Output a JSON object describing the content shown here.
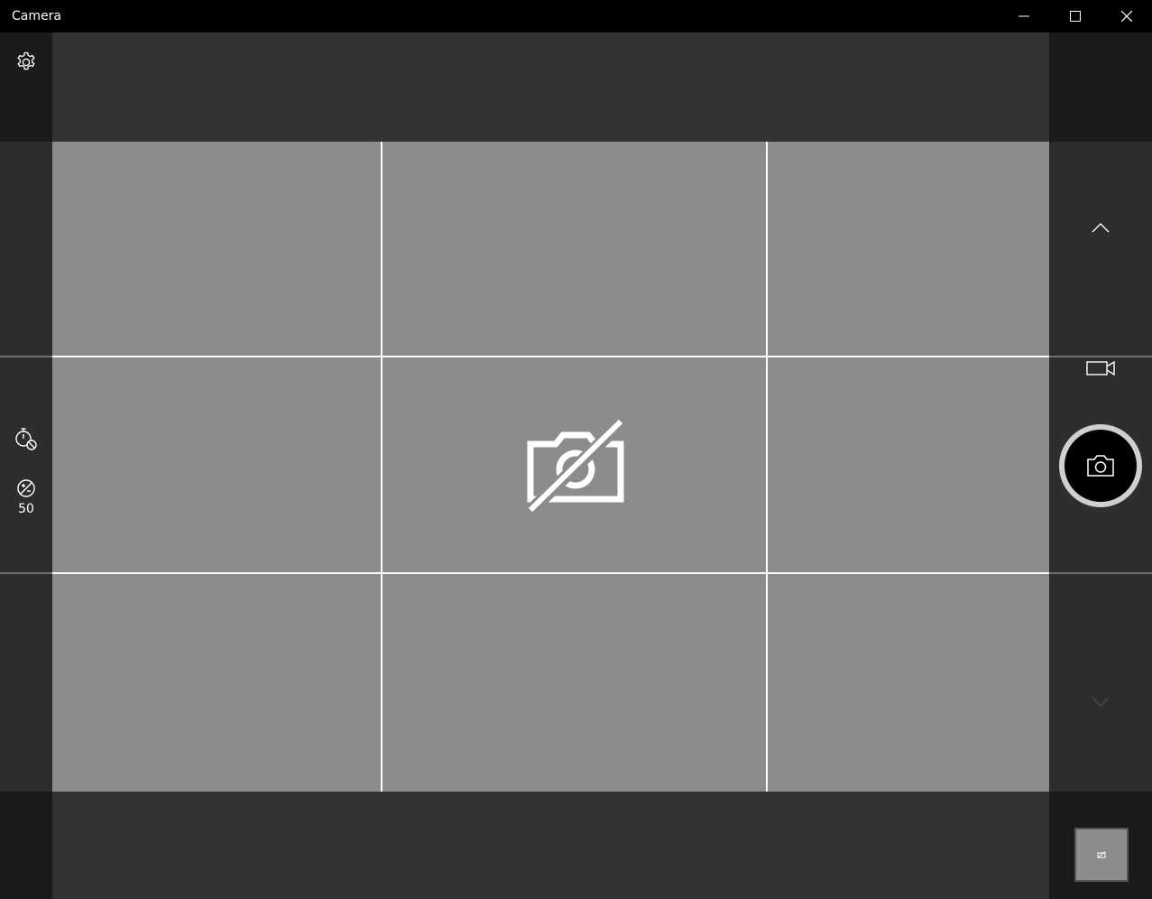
{
  "window": {
    "title": "Camera"
  },
  "left_panel": {
    "settings_icon": "gear-icon",
    "timer_icon": "timer-off-icon",
    "brightness_icon": "brightness-icon",
    "brightness_value": "50"
  },
  "right_panel": {
    "scroll_up_icon": "chevron-up-icon",
    "video_mode_icon": "video-camera-icon",
    "shutter_icon": "camera-icon",
    "scroll_down_icon": "chevron-down-icon",
    "thumbnail_icon": "no-camera-icon"
  },
  "viewfinder": {
    "status_icon": "no-camera-icon",
    "framing_grid": "3x3"
  },
  "colors": {
    "titlebar": "#000000",
    "panel": "#1b1b1b",
    "viewfinder": "#8c8c8d",
    "grid": "#ffffff",
    "shutter_ring": "#cfcfcf"
  }
}
